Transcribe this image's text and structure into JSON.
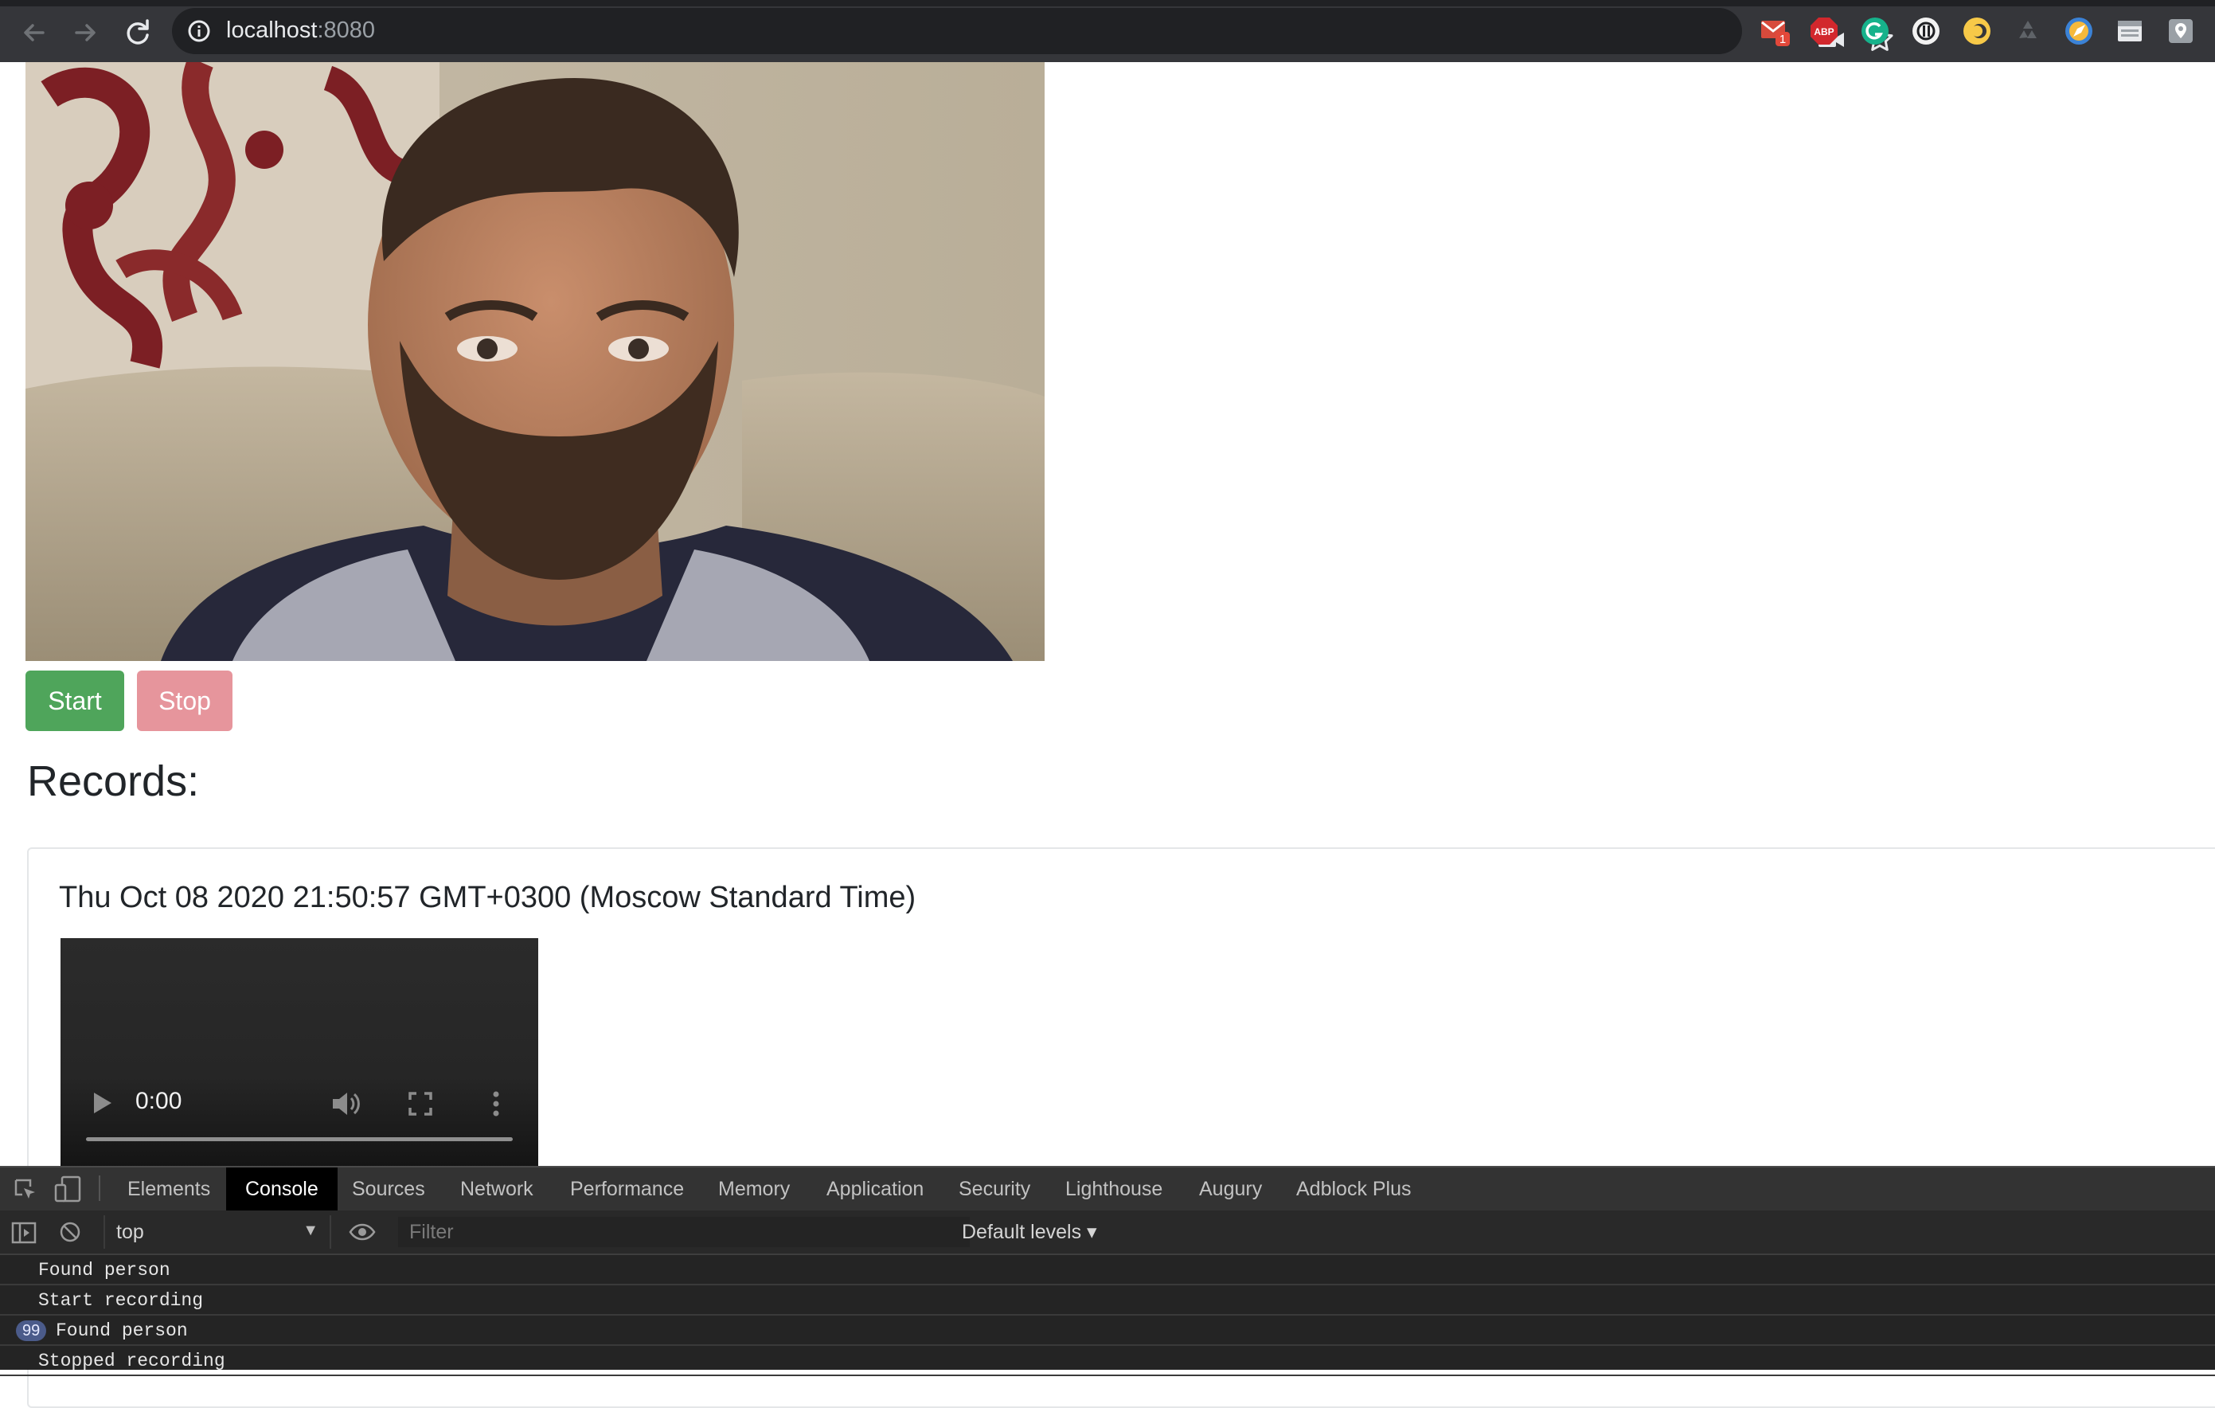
{
  "browser": {
    "url_host": "localhost",
    "url_port": ":8080",
    "extensions": [
      {
        "icon": "gmail-icon",
        "badge": "1"
      },
      {
        "icon": "adblock-plus-icon",
        "label": "ABP"
      },
      {
        "icon": "grammarly-icon"
      },
      {
        "icon": "extension-icon"
      },
      {
        "icon": "color-picker-icon"
      },
      {
        "icon": "recycle-icon"
      },
      {
        "icon": "compass-icon"
      },
      {
        "icon": "window-icon"
      },
      {
        "icon": "location-icon"
      }
    ]
  },
  "page": {
    "start_label": "Start",
    "stop_label": "Stop",
    "records_heading": "Records:",
    "records": [
      {
        "title": "Thu Oct 08 2020 21:50:57 GMT+0300 (Moscow Standard Time)",
        "time": "0:00"
      }
    ]
  },
  "devtools": {
    "tabs": [
      "Elements",
      "Console",
      "Sources",
      "Network",
      "Performance",
      "Memory",
      "Application",
      "Security",
      "Lighthouse",
      "Augury",
      "Adblock Plus"
    ],
    "active_tab": "Console",
    "context": "top",
    "filter_placeholder": "Filter",
    "levels": "Default levels ▾",
    "logs": [
      {
        "text": "Found person"
      },
      {
        "text": "Start recording"
      },
      {
        "text": "Found person",
        "count": "99"
      },
      {
        "text": "Stopped recording"
      }
    ]
  },
  "colors": {
    "start": "#4fa55b",
    "stop": "#e6959c",
    "chrome": "#35363a",
    "devtools": "#242424"
  }
}
